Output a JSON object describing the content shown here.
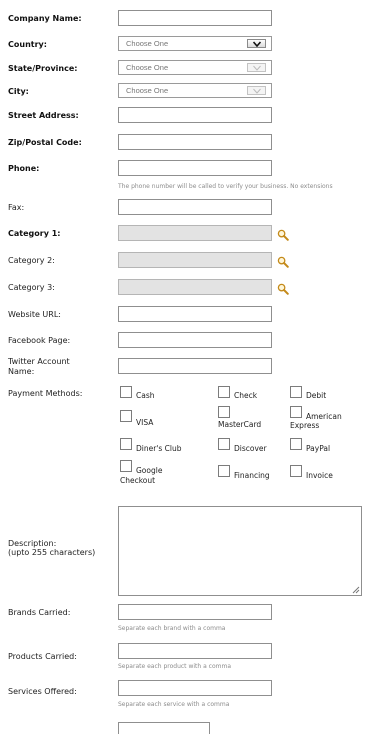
{
  "labels": {
    "company_name": "Company Name:",
    "country": "Country:",
    "state": "State/Province:",
    "city": "City:",
    "street": "Street Address:",
    "zip": "Zip/Postal Code:",
    "phone": "Phone:",
    "fax": "Fax:",
    "category1": "Category 1:",
    "category2": "Category 2:",
    "category3": "Category 3:",
    "website": "Website URL:",
    "facebook": "Facebook Page:",
    "twitter": "Twitter Account Name:",
    "payment": "Payment Methods:",
    "description": "Description:",
    "description_note": "(upto 255 characters)",
    "brands": "Brands Carried:",
    "products": "Products Carried:",
    "services": "Services Offered:"
  },
  "selects": {
    "country": "Choose One",
    "state": "Choose One",
    "city": "Choose One"
  },
  "hints": {
    "phone": "The phone number will be called to verify your business. No extensions",
    "brands": "Separate each brand with a comma",
    "products": "Separate each product with a comma",
    "services": "Separate each service with a comma"
  },
  "payment_methods": {
    "cash": "Cash",
    "check": "Check",
    "debit": "Debit",
    "visa": "VISA",
    "mastercard": "MasterCard",
    "amex_1": "American",
    "amex_2": "Express",
    "diners": "Diner's Club",
    "discover": "Discover",
    "paypal": "PayPal",
    "google_1": "Google",
    "google_2": "Checkout",
    "financing": "Financing",
    "invoice": "Invoice"
  },
  "icons": {
    "lookup": "magnifier-icon",
    "dropdown": "chevron-down-icon",
    "resize": "resize-grip-icon"
  }
}
